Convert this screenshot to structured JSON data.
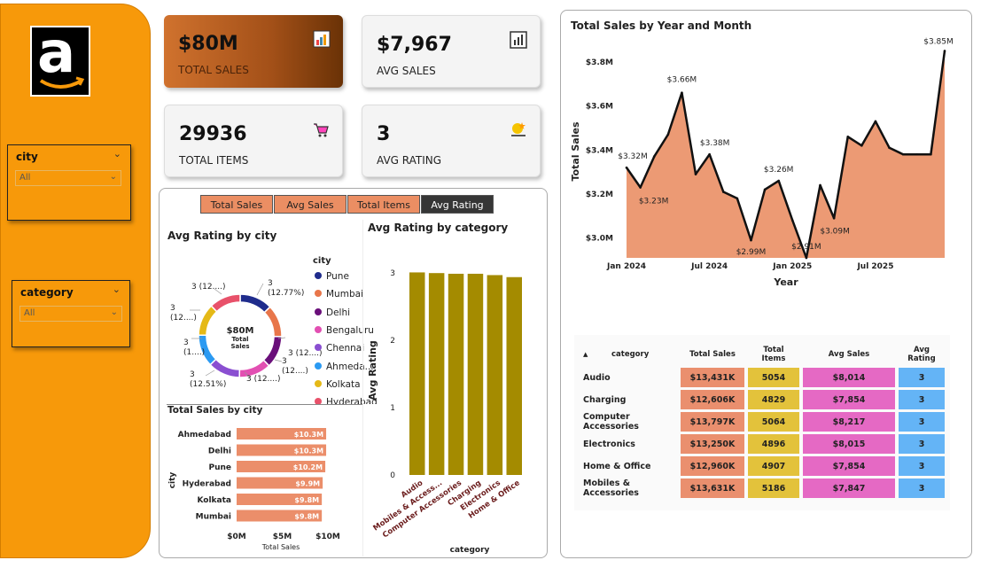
{
  "sidebar": {
    "logo_letter": "a",
    "slicers": [
      {
        "title": "city",
        "value": "All"
      },
      {
        "title": "category",
        "value": "All"
      }
    ]
  },
  "kpis": {
    "total_sales": {
      "value": "$80M",
      "label": "TOTAL SALES"
    },
    "avg_sales": {
      "value": "$7,967",
      "label": "AVG SALES"
    },
    "total_items": {
      "value": "29936",
      "label": "TOTAL ITEMS"
    },
    "avg_rating": {
      "value": "3",
      "label": "AVG RATING"
    }
  },
  "tabs": [
    "Total Sales",
    "Avg Sales",
    "Total Items",
    "Avg Rating"
  ],
  "donut": {
    "title": "Avg Rating by city",
    "center_value": "$80M",
    "center_label": "Total Sales",
    "legend_title": "city",
    "labels": [
      "3 (12....)",
      "3\n(12.77%)",
      "3 (12....)",
      "3\n(12....)",
      "3\n(1....)",
      "3\n(12.51%)",
      "3 (12....)",
      "3\n(12....)"
    ],
    "legend": [
      {
        "name": "Pune",
        "color": "#1f2c8c"
      },
      {
        "name": "Mumbai",
        "color": "#e8764a"
      },
      {
        "name": "Delhi",
        "color": "#6a0f7a"
      },
      {
        "name": "Bengaluru",
        "color": "#e24fb2"
      },
      {
        "name": "Chennai",
        "color": "#8a4fd1"
      },
      {
        "name": "Ahmeda...",
        "color": "#2b9af2"
      },
      {
        "name": "Kolkata",
        "color": "#e5b917"
      },
      {
        "name": "Hyderabad",
        "color": "#e8516a"
      }
    ]
  },
  "chart_data": [
    {
      "type": "pie",
      "title": "Avg Rating by city",
      "categories": [
        "Pune",
        "Mumbai",
        "Delhi",
        "Bengaluru",
        "Chennai",
        "Ahmedabad",
        "Kolkata",
        "Hyderabad"
      ],
      "values": [
        12.77,
        12.5,
        12.5,
        12.5,
        12.5,
        12.51,
        12.5,
        12.2
      ]
    },
    {
      "type": "bar",
      "orientation": "horizontal",
      "title": "Total Sales by city",
      "categories": [
        "Ahmedabad",
        "Delhi",
        "Pune",
        "Hyderabad",
        "Kolkata",
        "Mumbai"
      ],
      "values": [
        10.3,
        10.3,
        10.2,
        9.9,
        9.8,
        9.8
      ],
      "value_labels": [
        "$10.3M",
        "$10.3M",
        "$10.2M",
        "$9.9M",
        "$9.8M",
        "$9.8M"
      ],
      "xlabel": "Total Sales",
      "ylabel": "city",
      "xticks": [
        "$0M",
        "$5M",
        "$10M"
      ],
      "xlim": [
        0,
        10.5
      ]
    },
    {
      "type": "bar",
      "title": "Avg Rating by category",
      "categories": [
        "Audio",
        "Mobiles & Access...",
        "Computer Accessories",
        "Charging",
        "Electronics",
        "Home & Office"
      ],
      "values": [
        3.01,
        3.0,
        2.99,
        2.99,
        2.97,
        2.94
      ],
      "xlabel": "category",
      "ylabel": "Avg Rating",
      "yticks": [
        "0",
        "1",
        "2",
        "3"
      ],
      "ylim": [
        0,
        3.2
      ],
      "color": "#a48b00"
    },
    {
      "type": "area",
      "title": "Total Sales by Year and Month",
      "xlabel": "Year",
      "ylabel": "Total Sales",
      "xticks": [
        "Jan 2024",
        "Jul 2024",
        "Jan 2025",
        "Jul 2025"
      ],
      "yticks": [
        "$3.0M",
        "$3.2M",
        "$3.4M",
        "$3.6M",
        "$3.8M"
      ],
      "ylim": [
        2.91,
        3.88
      ],
      "x": [
        "2024-01",
        "2024-02",
        "2024-03",
        "2024-04",
        "2024-05",
        "2024-06",
        "2024-07",
        "2024-08",
        "2024-09",
        "2024-10",
        "2024-11",
        "2024-12",
        "2025-01",
        "2025-02",
        "2025-03",
        "2025-04",
        "2025-05",
        "2025-06",
        "2025-07",
        "2025-08",
        "2025-09",
        "2025-10",
        "2025-11",
        "2025-12"
      ],
      "values": [
        3.32,
        3.23,
        3.37,
        3.47,
        3.66,
        3.29,
        3.38,
        3.21,
        3.18,
        2.99,
        3.22,
        3.26,
        3.08,
        2.91,
        3.24,
        3.09,
        3.46,
        3.42,
        3.53,
        3.41,
        3.38,
        3.38,
        3.38,
        3.85
      ],
      "point_labels": [
        {
          "index": 0,
          "text": "$3.32M"
        },
        {
          "index": 1,
          "text": "$3.23M"
        },
        {
          "index": 4,
          "text": "$3.66M"
        },
        {
          "index": 6,
          "text": "$3.38M"
        },
        {
          "index": 9,
          "text": "$2.99M"
        },
        {
          "index": 11,
          "text": "$3.26M"
        },
        {
          "index": 13,
          "text": "$2.91M"
        },
        {
          "index": 15,
          "text": "$3.09M"
        },
        {
          "index": 23,
          "text": "$3.85M"
        }
      ],
      "color": "#ec9a74"
    }
  ],
  "matrix": {
    "headers": [
      "category",
      "Total Sales",
      "Total Items",
      "Avg Sales",
      "Avg Rating"
    ],
    "rows": [
      [
        "Audio",
        "$13,431K",
        "5054",
        "$8,014",
        "3"
      ],
      [
        "Charging",
        "$12,606K",
        "4829",
        "$7,854",
        "3"
      ],
      [
        "Computer Accessories",
        "$13,797K",
        "5064",
        "$8,217",
        "3"
      ],
      [
        "Electronics",
        "$13,250K",
        "4896",
        "$8,015",
        "3"
      ],
      [
        "Home & Office",
        "$12,960K",
        "4907",
        "$7,854",
        "3"
      ],
      [
        "Mobiles & Accessories",
        "$13,631K",
        "5186",
        "$7,847",
        "3"
      ]
    ],
    "colors": [
      "#ea8f6e",
      "#e3c23b",
      "#e569c4",
      "#64b4f6"
    ]
  }
}
